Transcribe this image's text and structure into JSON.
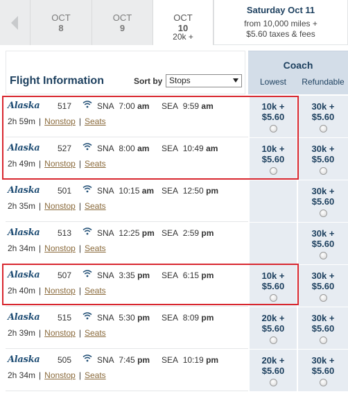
{
  "date_strip": {
    "prev_arrow_icon": "chevron-left-icon",
    "dates": [
      {
        "month": "OCT",
        "day": "8",
        "price": ""
      },
      {
        "month": "OCT",
        "day": "9",
        "price": ""
      },
      {
        "month": "OCT",
        "day": "10",
        "price": "20k +"
      }
    ],
    "selected": {
      "title": "Saturday Oct 11",
      "line1": "from 10,000 miles +",
      "line2": "$5.60 taxes & fees"
    }
  },
  "header": {
    "title": "Flight Information",
    "sort_label": "Sort by",
    "sort_value": "Stops"
  },
  "cabin": {
    "name": "Coach",
    "col_lowest": "Lowest",
    "col_refundable": "Refundable"
  },
  "separators": {
    "bar": "|"
  },
  "flights": [
    {
      "airline_logo": "Alaska",
      "flight": "517",
      "wifi_icon": "wifi-icon",
      "from": "SNA",
      "dep_time": "7:00",
      "dep_ampm": "am",
      "to": "SEA",
      "arr_time": "9:59",
      "arr_ampm": "am",
      "duration": "2h 59m",
      "stops": "Nonstop",
      "seats": "Seats",
      "lowest_miles": "10k +",
      "lowest_tax": "$5.60",
      "ref_miles": "30k +",
      "ref_tax": "$5.60"
    },
    {
      "airline_logo": "Alaska",
      "flight": "527",
      "wifi_icon": "wifi-icon",
      "from": "SNA",
      "dep_time": "8:00",
      "dep_ampm": "am",
      "to": "SEA",
      "arr_time": "10:49",
      "arr_ampm": "am",
      "duration": "2h 49m",
      "stops": "Nonstop",
      "seats": "Seats",
      "lowest_miles": "10k +",
      "lowest_tax": "$5.60",
      "ref_miles": "30k +",
      "ref_tax": "$5.60"
    },
    {
      "airline_logo": "Alaska",
      "flight": "501",
      "wifi_icon": "wifi-icon",
      "from": "SNA",
      "dep_time": "10:15",
      "dep_ampm": "am",
      "to": "SEA",
      "arr_time": "12:50",
      "arr_ampm": "pm",
      "duration": "2h 35m",
      "stops": "Nonstop",
      "seats": "Seats",
      "lowest_miles": "",
      "lowest_tax": "",
      "ref_miles": "30k +",
      "ref_tax": "$5.60"
    },
    {
      "airline_logo": "Alaska",
      "flight": "513",
      "wifi_icon": "wifi-icon",
      "from": "SNA",
      "dep_time": "12:25",
      "dep_ampm": "pm",
      "to": "SEA",
      "arr_time": "2:59",
      "arr_ampm": "pm",
      "duration": "2h 34m",
      "stops": "Nonstop",
      "seats": "Seats",
      "lowest_miles": "",
      "lowest_tax": "",
      "ref_miles": "30k +",
      "ref_tax": "$5.60"
    },
    {
      "airline_logo": "Alaska",
      "flight": "507",
      "wifi_icon": "wifi-icon",
      "from": "SNA",
      "dep_time": "3:35",
      "dep_ampm": "pm",
      "to": "SEA",
      "arr_time": "6:15",
      "arr_ampm": "pm",
      "duration": "2h 40m",
      "stops": "Nonstop",
      "seats": "Seats",
      "lowest_miles": "10k +",
      "lowest_tax": "$5.60",
      "ref_miles": "30k +",
      "ref_tax": "$5.60"
    },
    {
      "airline_logo": "Alaska",
      "flight": "515",
      "wifi_icon": "wifi-icon",
      "from": "SNA",
      "dep_time": "5:30",
      "dep_ampm": "pm",
      "to": "SEA",
      "arr_time": "8:09",
      "arr_ampm": "pm",
      "duration": "2h 39m",
      "stops": "Nonstop",
      "seats": "Seats",
      "lowest_miles": "20k +",
      "lowest_tax": "$5.60",
      "ref_miles": "30k +",
      "ref_tax": "$5.60"
    },
    {
      "airline_logo": "Alaska",
      "flight": "505",
      "wifi_icon": "wifi-icon",
      "from": "SNA",
      "dep_time": "7:45",
      "dep_ampm": "pm",
      "to": "SEA",
      "arr_time": "10:19",
      "arr_ampm": "pm",
      "duration": "2h 34m",
      "stops": "Nonstop",
      "seats": "Seats",
      "lowest_miles": "20k +",
      "lowest_tax": "$5.60",
      "ref_miles": "30k +",
      "ref_tax": "$5.60"
    }
  ],
  "highlight_color": "#d8262e"
}
